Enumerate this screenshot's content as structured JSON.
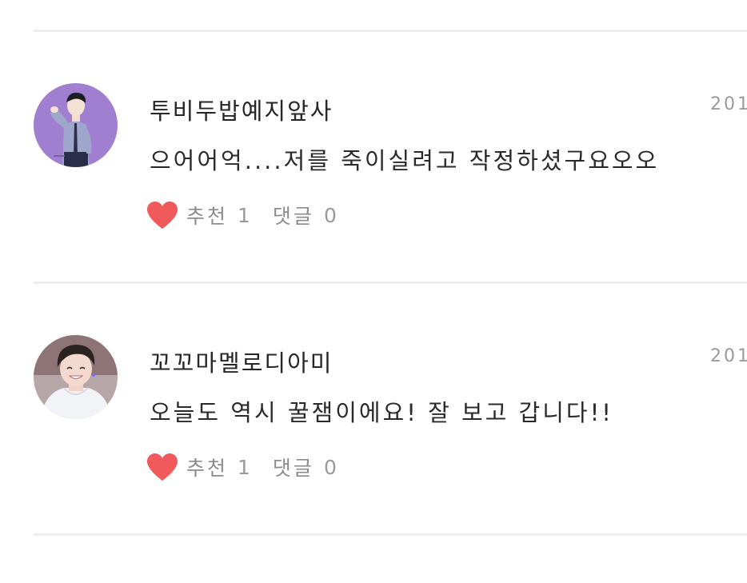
{
  "comments": [
    {
      "username": "투비두밥예지앞사",
      "date": "201",
      "text": "으어어억....저를 죽이실려고 작정하셨구요오오",
      "like_label": "추천",
      "like_count": "1",
      "reply_label": "댓글",
      "reply_count": "0",
      "avatar": "avatar-saluting-man-purple-bg"
    },
    {
      "username": "꼬꼬마멜로디아미",
      "date": "201",
      "text": "오늘도 역시 꿀잼이에요! 잘 보고 갑니다!!",
      "like_label": "추천",
      "like_count": "1",
      "reply_label": "댓글",
      "reply_count": "0",
      "avatar": "avatar-smiling-person-photo"
    }
  ],
  "colors": {
    "heart": "#f05a5a",
    "divider": "#eeeeee",
    "muted_text": "#8c8c8c"
  }
}
